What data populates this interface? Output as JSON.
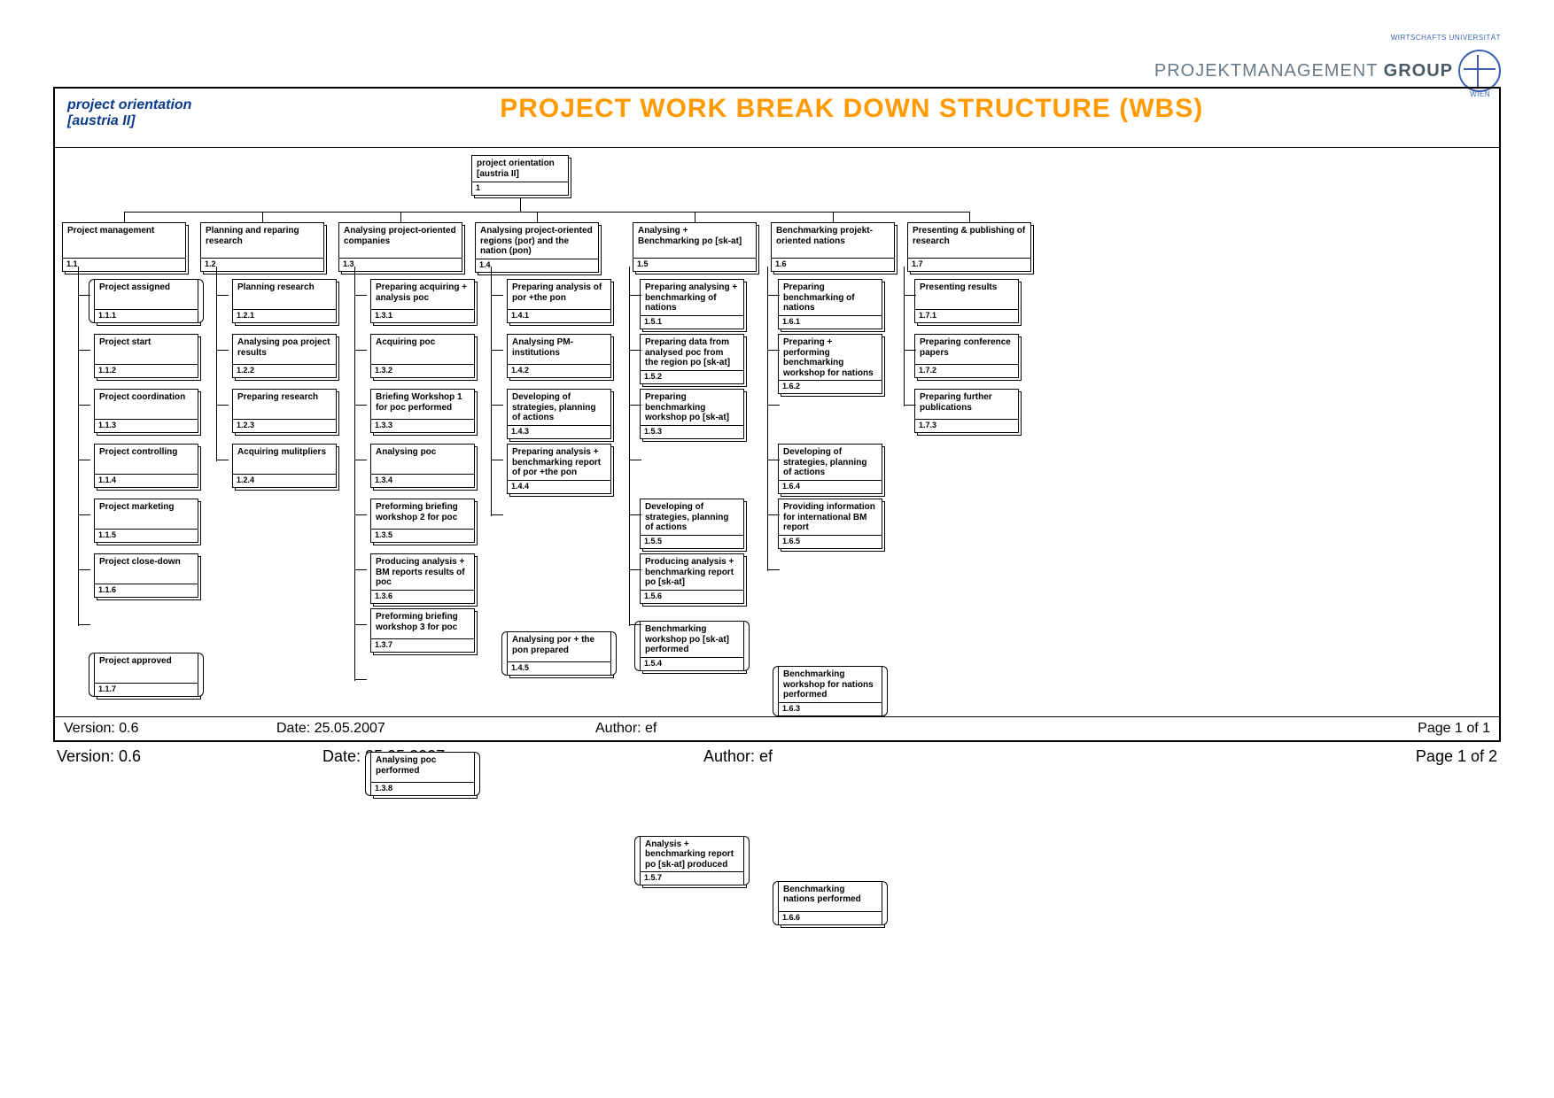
{
  "brand": {
    "text_a": "PROJEKTMANAGEMENT ",
    "text_b": "GROUP",
    "cap_top": "WIRTSCHAFTS UNIVERSITÄT",
    "cap_bottom": "WIEN"
  },
  "header": {
    "left": "project orientation\n[austria II]",
    "title": "PROJECT WORK BREAK DOWN STRUCTURE\n(WBS)"
  },
  "root": {
    "label": "project orientation [austria II]",
    "num": "1"
  },
  "columns": [
    {
      "label": "Project management",
      "num": "1.1",
      "children": [
        {
          "label": "Project assigned",
          "num": "1.1.1",
          "milestone": true
        },
        {
          "label": "Project start",
          "num": "1.1.2"
        },
        {
          "label": "Project coordination",
          "num": "1.1.3"
        },
        {
          "label": "Project controlling",
          "num": "1.1.4"
        },
        {
          "label": "Project marketing",
          "num": "1.1.5"
        },
        {
          "label": "Project close-down",
          "num": "1.1.6"
        },
        {
          "label": "Project approved",
          "num": "1.1.7",
          "milestone": true
        }
      ]
    },
    {
      "label": "Planning and reparing research",
      "num": "1.2",
      "children": [
        {
          "label": "Planning research",
          "num": "1.2.1"
        },
        {
          "label": "Analysing poa project results",
          "num": "1.2.2"
        },
        {
          "label": "Preparing research",
          "num": "1.2.3"
        },
        {
          "label": "Acquiring mulitpliers",
          "num": "1.2.4"
        }
      ]
    },
    {
      "label": "Analysing project-oriented companies",
      "num": "1.3",
      "children": [
        {
          "label": "Preparing acquiring + analysis poc",
          "num": "1.3.1"
        },
        {
          "label": "Acquiring poc",
          "num": "1.3.2"
        },
        {
          "label": "Briefing Workshop 1 for poc performed",
          "num": "1.3.3"
        },
        {
          "label": "Analysing poc",
          "num": "1.3.4"
        },
        {
          "label": "Preforming briefing workshop 2 for poc",
          "num": "1.3.5"
        },
        {
          "label": "Producing analysis + BM reports results of poc",
          "num": "1.3.6"
        },
        {
          "label": "Preforming briefing workshop 3 for poc",
          "num": "1.3.7"
        },
        {
          "label": "Analysing poc performed",
          "num": "1.3.8",
          "milestone": true
        }
      ]
    },
    {
      "label": "Analysing project-oriented regions (por) and the nation (pon)",
      "num": "1.4",
      "children": [
        {
          "label": "Preparing analysis of por +the pon",
          "num": "1.4.1"
        },
        {
          "label": "Analysing PM-institutions",
          "num": "1.4.2"
        },
        {
          "label": "Developing of strategies, planning of actions",
          "num": "1.4.3"
        },
        {
          "label": "Preparing analysis + benchmarking report of por +the pon",
          "num": "1.4.4"
        },
        {
          "label": "Analysing por + the pon prepared",
          "num": "1.4.5",
          "milestone": true
        }
      ]
    },
    {
      "label": "Analysing + Benchmarking po [sk-at]",
      "num": "1.5",
      "children": [
        {
          "label": "Preparing analysing + benchmarking of nations",
          "num": "1.5.1"
        },
        {
          "label": "Preparing data from analysed poc from the region po [sk-at]",
          "num": "1.5.2"
        },
        {
          "label": "Preparing benchmarking workshop po [sk-at]",
          "num": "1.5.3"
        },
        {
          "label": "Benchmarking workshop po [sk-at] performed",
          "num": "1.5.4",
          "milestone": true
        },
        {
          "label": "Developing of strategies, planning of actions",
          "num": "1.5.5"
        },
        {
          "label": "Producing analysis + benchmarking report po [sk-at]",
          "num": "1.5.6"
        },
        {
          "label": "Analysis + benchmarking report po [sk-at] produced",
          "num": "1.5.7",
          "milestone": true
        }
      ]
    },
    {
      "label": "Benchmarking projekt-oriented nations",
      "num": "1.6",
      "children": [
        {
          "label": "Preparing benchmarking of nations",
          "num": "1.6.1"
        },
        {
          "label": "Preparing + performing benchmarking workshop for nations",
          "num": "1.6.2"
        },
        {
          "label": "Benchmarking workshop for nations performed",
          "num": "1.6.3",
          "milestone": true
        },
        {
          "label": "Developing of strategies, planning of actions",
          "num": "1.6.4"
        },
        {
          "label": "Providing information for international BM report",
          "num": "1.6.5"
        },
        {
          "label": "Benchmarking nations performed",
          "num": "1.6.6",
          "milestone": true
        }
      ]
    },
    {
      "label": "Presenting & publishing of research",
      "num": "1.7",
      "children": [
        {
          "label": "Presenting results",
          "num": "1.7.1"
        },
        {
          "label": "Preparing conference papers",
          "num": "1.7.2"
        },
        {
          "label": "Preparing further publications",
          "num": "1.7.3"
        }
      ]
    }
  ],
  "frame_footer": {
    "version": "Version: 0.6",
    "date": "Date: 25.05.2007",
    "author": "Author: ef",
    "page": "Page 1 of 1"
  },
  "page_footer": {
    "version": "Version: 0.6",
    "date": "Date: 25.05.2007",
    "author": "Author: ef",
    "page": "Page 1 of 2"
  }
}
